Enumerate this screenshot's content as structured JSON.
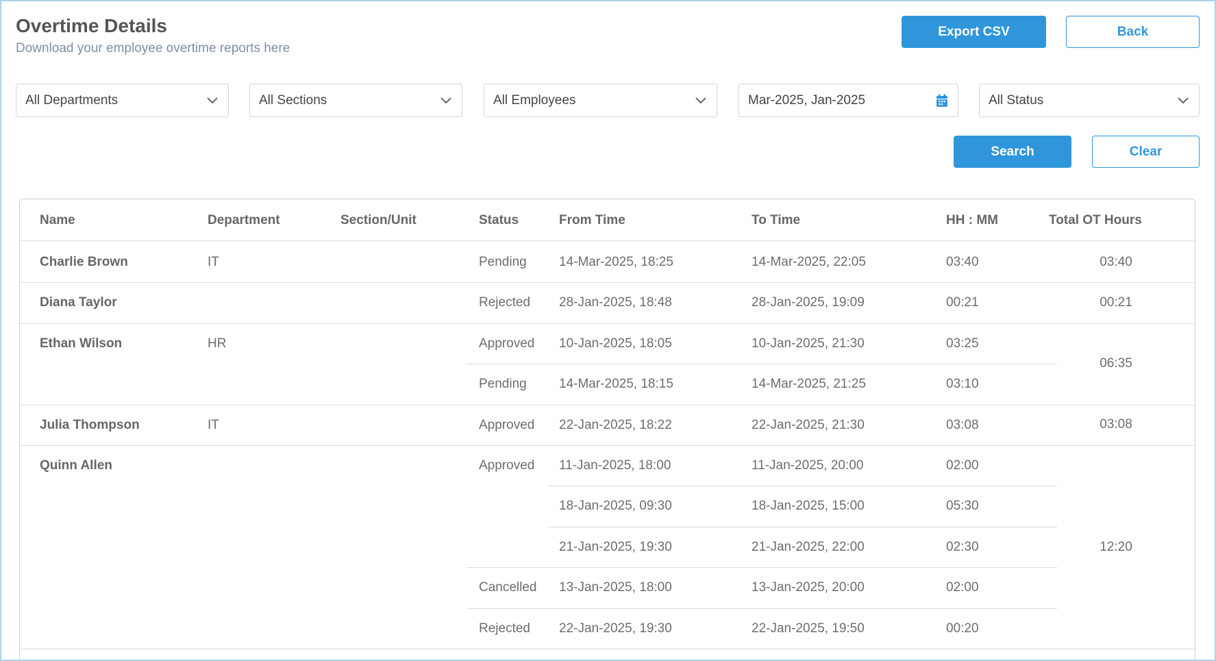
{
  "header": {
    "title": "Overtime Details",
    "subtitle": "Download your employee overtime reports here",
    "export_label": "Export CSV",
    "back_label": "Back"
  },
  "filters": {
    "department": "All Departments",
    "section": "All Sections",
    "employee": "All Employees",
    "date_range": "Mar-2025, Jan-2025",
    "status": "All Status",
    "search_label": "Search",
    "clear_label": "Clear"
  },
  "colors": {
    "accent": "#2f96dc",
    "border": "#a9d4ea"
  },
  "icons": {
    "dropdown": "chevron-down-icon",
    "date": "calendar-icon"
  },
  "table": {
    "columns": [
      "Name",
      "Department",
      "Section/Unit",
      "Status",
      "From Time",
      "To Time",
      "HH : MM",
      "Total OT Hours"
    ],
    "employees": [
      {
        "name": "Charlie Brown",
        "department": "IT",
        "section": "",
        "total": "03:40",
        "groups": [
          {
            "status": "Pending",
            "entries": [
              {
                "from": "14-Mar-2025, 18:25",
                "to": "14-Mar-2025, 22:05",
                "hhmm": "03:40"
              }
            ]
          }
        ]
      },
      {
        "name": "Diana Taylor",
        "department": "",
        "section": "",
        "total": "00:21",
        "groups": [
          {
            "status": "Rejected",
            "entries": [
              {
                "from": "28-Jan-2025, 18:48",
                "to": "28-Jan-2025, 19:09",
                "hhmm": "00:21"
              }
            ]
          }
        ]
      },
      {
        "name": "Ethan Wilson",
        "department": "HR",
        "section": "",
        "total": "06:35",
        "groups": [
          {
            "status": "Approved",
            "entries": [
              {
                "from": "10-Jan-2025, 18:05",
                "to": "10-Jan-2025, 21:30",
                "hhmm": "03:25"
              }
            ]
          },
          {
            "status": "Pending",
            "entries": [
              {
                "from": "14-Mar-2025, 18:15",
                "to": "14-Mar-2025, 21:25",
                "hhmm": "03:10"
              }
            ]
          }
        ]
      },
      {
        "name": "Julia Thompson",
        "department": "IT",
        "section": "",
        "total": "03:08",
        "groups": [
          {
            "status": "Approved",
            "entries": [
              {
                "from": "22-Jan-2025, 18:22",
                "to": "22-Jan-2025, 21:30",
                "hhmm": "03:08"
              }
            ]
          }
        ]
      },
      {
        "name": "Quinn Allen",
        "department": "",
        "section": "",
        "total": "12:20",
        "groups": [
          {
            "status": "Approved",
            "entries": [
              {
                "from": "11-Jan-2025, 18:00",
                "to": "11-Jan-2025, 20:00",
                "hhmm": "02:00"
              },
              {
                "from": "18-Jan-2025, 09:30",
                "to": "18-Jan-2025, 15:00",
                "hhmm": "05:30"
              },
              {
                "from": "21-Jan-2025, 19:30",
                "to": "21-Jan-2025, 22:00",
                "hhmm": "02:30"
              }
            ]
          },
          {
            "status": "Cancelled",
            "entries": [
              {
                "from": "13-Jan-2025, 18:00",
                "to": "13-Jan-2025, 20:00",
                "hhmm": "02:00"
              }
            ]
          },
          {
            "status": "Rejected",
            "entries": [
              {
                "from": "22-Jan-2025, 19:30",
                "to": "22-Jan-2025, 19:50",
                "hhmm": "00:20"
              }
            ]
          }
        ]
      }
    ]
  }
}
